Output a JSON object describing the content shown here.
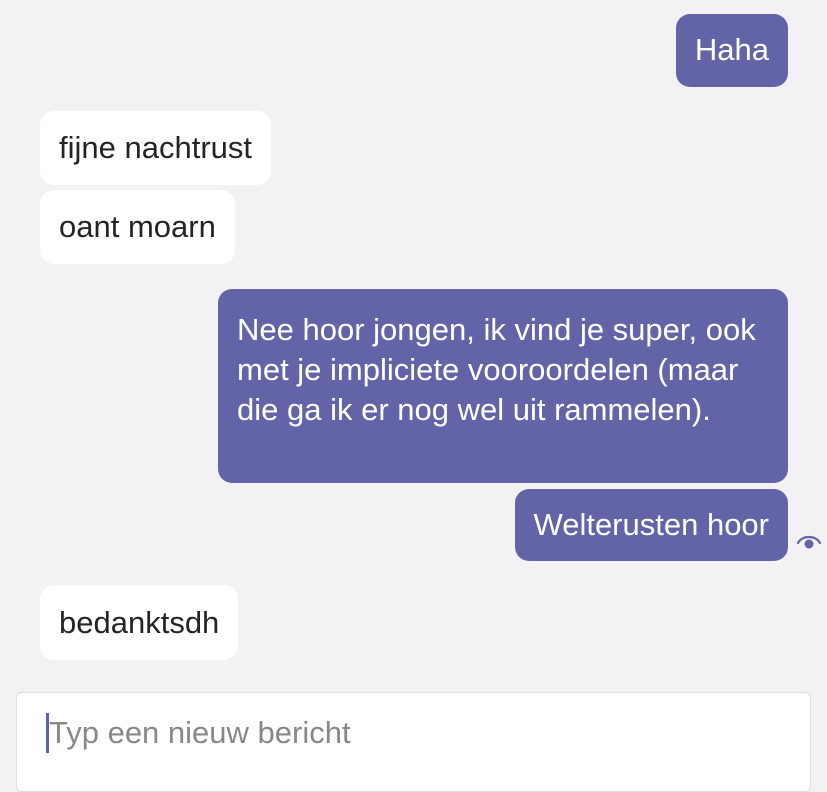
{
  "chat": {
    "messages": [
      {
        "direction": "outgoing",
        "text": "Haha"
      },
      {
        "direction": "incoming",
        "text": "fijne nachtrust"
      },
      {
        "direction": "incoming",
        "text": "oant moarn"
      },
      {
        "direction": "outgoing",
        "text": "Nee hoor jongen, ik vind je super, ook met je impliciete vooroordelen (maar die ga ik er nog wel uit rammelen)."
      },
      {
        "direction": "outgoing",
        "text": "Welterusten hoor",
        "read_receipt_icon": "eye-icon"
      },
      {
        "direction": "incoming",
        "text": "bedanktsdh"
      }
    ]
  },
  "composer": {
    "placeholder": "Typ een nieuw bericht",
    "value": ""
  },
  "colors": {
    "outgoing_bubble": "#6264a7",
    "incoming_bubble": "#ffffff",
    "background": "#f3f1f3"
  }
}
